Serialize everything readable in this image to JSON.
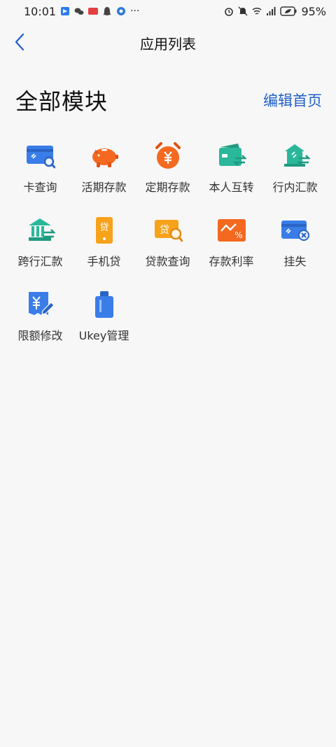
{
  "status": {
    "time": "10:01",
    "battery": "95%"
  },
  "nav": {
    "title": "应用列表"
  },
  "section": {
    "title": "全部模块",
    "edit_label": "编辑首页"
  },
  "modules": [
    {
      "label": "卡查询",
      "icon": "card-search-icon",
      "color": "#3a7de8"
    },
    {
      "label": "活期存款",
      "icon": "piggy-bank-icon",
      "color": "#f4691f"
    },
    {
      "label": "定期存款",
      "icon": "alarm-clock-yuan-icon",
      "color": "#f4691f"
    },
    {
      "label": "本人互转",
      "icon": "wallet-transfer-icon",
      "color": "#2ab79a"
    },
    {
      "label": "行内汇款",
      "icon": "bank-transfer-icon",
      "color": "#2ab79a"
    },
    {
      "label": "跨行汇款",
      "icon": "bank-building-icon",
      "color": "#2ab79a"
    },
    {
      "label": "手机贷",
      "icon": "phone-loan-icon",
      "color": "#f7a21b"
    },
    {
      "label": "贷款查询",
      "icon": "loan-search-icon",
      "color": "#f7a21b"
    },
    {
      "label": "存款利率",
      "icon": "rate-chart-icon",
      "color": "#f4691f"
    },
    {
      "label": "挂失",
      "icon": "card-lock-icon",
      "color": "#3a7de8"
    },
    {
      "label": "限额修改",
      "icon": "limit-edit-icon",
      "color": "#3a7de8"
    },
    {
      "label": "Ukey管理",
      "icon": "ukey-icon",
      "color": "#3a7de8"
    }
  ]
}
